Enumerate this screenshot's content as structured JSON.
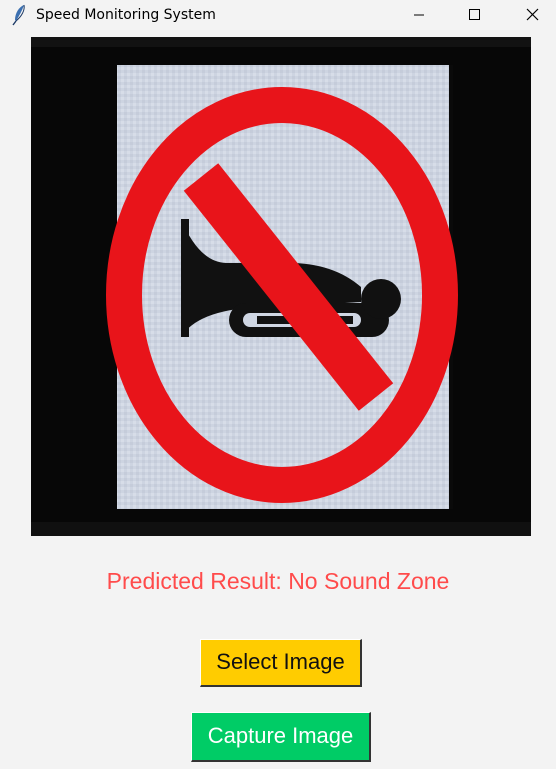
{
  "window": {
    "title": "Speed Monitoring System",
    "icon": "feather-icon",
    "controls": [
      "minimize-icon",
      "maximize-icon",
      "close-icon"
    ]
  },
  "image": {
    "content": "no-horn-sign",
    "colors": {
      "ring": "#e8141a",
      "board": "#cfd6e3",
      "horn": "#111111",
      "background": "#070707"
    }
  },
  "result": {
    "text": "Predicted Result: No Sound Zone",
    "color": "#ff4b4b"
  },
  "buttons": {
    "select_label": "Select Image",
    "select_color": "#ffcc00",
    "capture_label": "Capture Image",
    "capture_color": "#00cc66"
  }
}
